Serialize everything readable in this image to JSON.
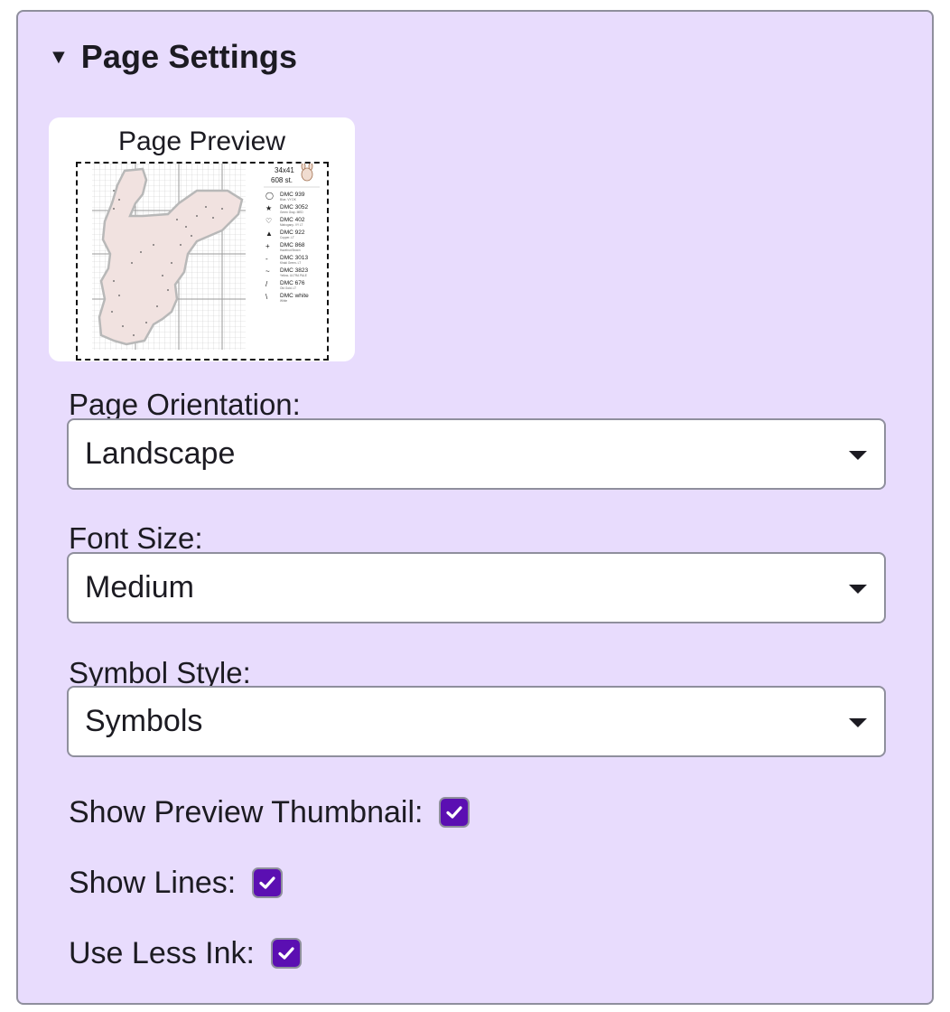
{
  "panel": {
    "title": "Page Settings",
    "caret_glyph": "▼"
  },
  "preview": {
    "title": "Page Preview",
    "info_line1": "34x41",
    "info_line2": "608 st.",
    "legend": [
      {
        "symbol": "◯",
        "code": "DMC 939",
        "name": "Blue- VY DK"
      },
      {
        "symbol": "★",
        "code": "DMC 3052",
        "name": "Green Gray- MED"
      },
      {
        "symbol": "♡",
        "code": "DMC 402",
        "name": "Mahogany- VY LT"
      },
      {
        "symbol": "▲",
        "code": "DMC 922",
        "name": "Copper- LT"
      },
      {
        "symbol": "+",
        "code": "DMC 868",
        "name": "Hazelnut Brown"
      },
      {
        "symbol": "-",
        "code": "DMC 3013",
        "name": "Khaki Green- LT"
      },
      {
        "symbol": "~",
        "code": "DMC 3823",
        "name": "Yellow- ULTRA PALE"
      },
      {
        "symbol": "/",
        "code": "DMC 676",
        "name": "Old Gold- LT"
      },
      {
        "symbol": "\\",
        "code": "DMC white",
        "name": "White"
      }
    ]
  },
  "fields": {
    "orientation": {
      "label": "Page Orientation:",
      "value": "Landscape"
    },
    "font_size": {
      "label": "Font Size:",
      "value": "Medium"
    },
    "symbol_style": {
      "label": "Symbol Style:",
      "value": "Symbols"
    }
  },
  "checks": {
    "thumbnail": {
      "label": "Show Preview Thumbnail:",
      "checked": true
    },
    "lines": {
      "label": "Show Lines:",
      "checked": true
    },
    "less_ink": {
      "label": "Use Less Ink:",
      "checked": true
    }
  },
  "colors": {
    "panel_bg": "#e8dcfd",
    "checkbox_accent": "#5b0fb2",
    "border": "#8f8f9d"
  }
}
